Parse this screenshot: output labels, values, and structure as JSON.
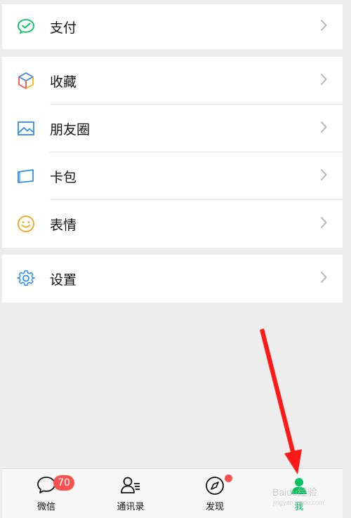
{
  "menu": {
    "pay": {
      "label": "支付",
      "icon": "wechat-pay-icon"
    },
    "items": [
      {
        "label": "收藏",
        "icon": "favorites-cube-icon"
      },
      {
        "label": "朋友圈",
        "icon": "moments-photo-icon"
      },
      {
        "label": "卡包",
        "icon": "card-wallet-icon"
      },
      {
        "label": "表情",
        "icon": "sticker-smile-icon"
      }
    ],
    "settings": {
      "label": "设置",
      "icon": "gear-icon"
    }
  },
  "tabbar": {
    "tabs": [
      {
        "label": "微信",
        "icon": "chat-bubble-icon",
        "badge": "70"
      },
      {
        "label": "通讯录",
        "icon": "contacts-icon"
      },
      {
        "label": "发现",
        "icon": "compass-icon",
        "dot": true
      },
      {
        "label": "我",
        "icon": "me-icon",
        "active": true
      }
    ]
  },
  "watermark": {
    "text": "Baidu经验",
    "subtext": "jingyan.baidu.com"
  },
  "colors": {
    "accent": "#07c160",
    "badge": "#fa5151",
    "arrow": "#ff1a1a",
    "background": "#ededed"
  }
}
